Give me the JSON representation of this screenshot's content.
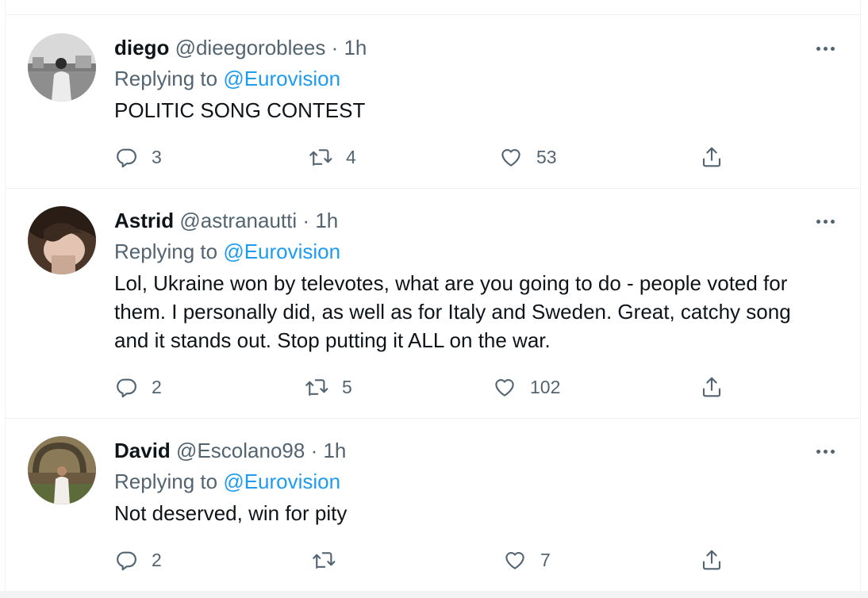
{
  "colors": {
    "link": "#1d9bf0",
    "secondary": "#536471",
    "text": "#0f1419",
    "divider": "#eff3f4"
  },
  "tweets": [
    {
      "name": "diego",
      "handle": "@dieegoroblees",
      "dot": "·",
      "time": "1h",
      "replying_prefix": "Replying to",
      "replying_to": "@Eurovision",
      "text": "POLITIC SONG CONTEST",
      "replies": "3",
      "retweets": "4",
      "likes": "53"
    },
    {
      "name": "Astrid",
      "handle": "@astranautti",
      "dot": "·",
      "time": "1h",
      "replying_prefix": "Replying to",
      "replying_to": "@Eurovision",
      "text": "Lol, Ukraine won by televotes, what are you going to do - people voted for them. I personally did, as well as for Italy and Sweden. Great, catchy song and it stands out. Stop putting it ALL on the war.",
      "replies": "2",
      "retweets": "5",
      "likes": "102"
    },
    {
      "name": "David",
      "handle": "@Escolano98",
      "dot": "·",
      "time": "1h",
      "replying_prefix": "Replying to",
      "replying_to": "@Eurovision",
      "text": "Not deserved, win for pity",
      "replies": "2",
      "retweets": "",
      "likes": "7"
    }
  ],
  "icons": [
    "more-icon",
    "reply-icon",
    "retweet-icon",
    "like-icon",
    "share-icon"
  ]
}
